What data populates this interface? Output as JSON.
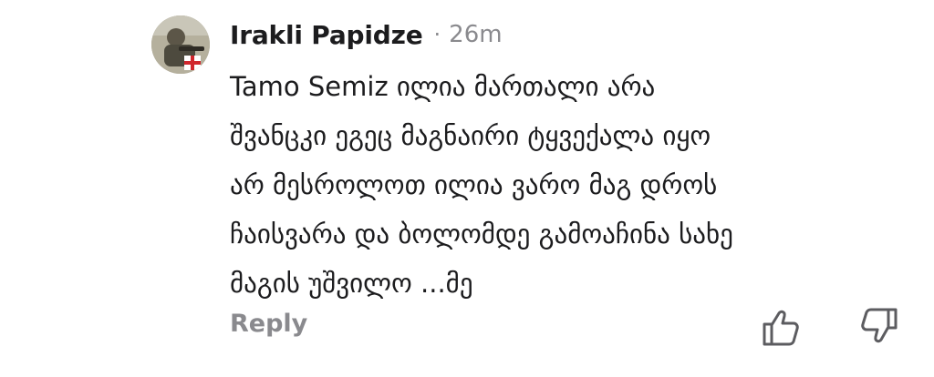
{
  "comment": {
    "author": "Irakli Papidze",
    "separator": "·",
    "time": "26m",
    "avatar_icon": "user-photo-avatar",
    "lines": [
      "Tamo Semiz ილია მართალი არა",
      "შვანცკი ეგეც მაგნაირი ტყვექალა იყო",
      "არ მესროლოთ ილია ვარო მაგ დროს",
      "ჩაისვარა და ბოლომდე გამოაჩინა სახე",
      "მაგის უშვილო ...მე"
    ]
  },
  "actions": {
    "reply_label": "Reply",
    "like_icon": "thumbs-up-icon",
    "dislike_icon": "thumbs-down-icon"
  },
  "colors": {
    "text": "#1c1c1e",
    "muted": "#8a8a8e",
    "background": "#ffffff"
  }
}
